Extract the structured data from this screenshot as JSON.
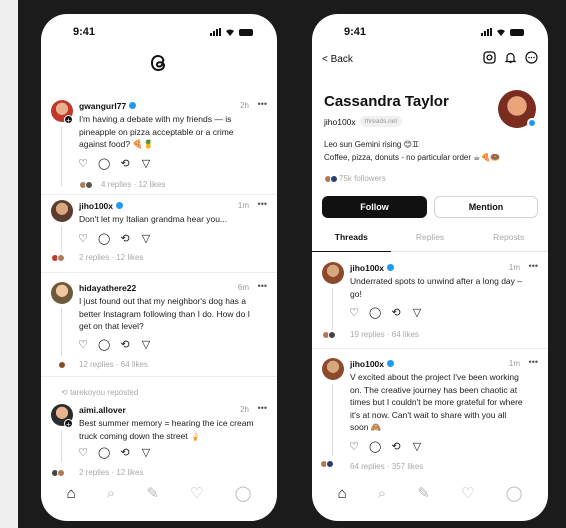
{
  "left_phone": {
    "status_time": "9:41",
    "logo": "@",
    "posts": [
      {
        "username": "gwangurl77",
        "time": "2h",
        "more": "•••",
        "text_lines": [
          "I'm having a debate with my friends — is",
          "pineapple on pizza acceptable or a crime",
          "against food? 🍕🍍"
        ],
        "stats": "4 replies · 12 likes"
      },
      {
        "username": "jiho100x",
        "time": "1m",
        "more": "•••",
        "text_lines": [
          "Don't let my Italian grandma hear you..."
        ],
        "stats": "2 replies · 12 likes"
      },
      {
        "username": "hidayathere22",
        "time": "6m",
        "more": "•••",
        "text_lines": [
          "I just found out that my neighbor's dog has a",
          "better Instagram following than I do. How do I",
          "get on that level?"
        ],
        "stats": "12 replies · 64 likes"
      },
      {
        "reposted_by": "tarekoyou reposted",
        "username": "aimi.allover",
        "time": "2h",
        "more": "•••",
        "text_lines": [
          "Best summer memory = hearing the ice cream",
          "truck coming down the street 🍦"
        ],
        "stats": "2 replies · 12 likes"
      }
    ]
  },
  "right_phone": {
    "status_time": "9:41",
    "back_label": "< Back",
    "profile": {
      "name": "Cassandra Taylor",
      "handle": "jiho100x",
      "chip": "threads.net",
      "bio_line1": "Leo sun Gemini rising 😊♊",
      "bio_line2": "Coffee, pizza, donuts - no particular order ☕🍕🍩",
      "followers": "75k followers"
    },
    "buttons": {
      "follow": "Follow",
      "mention": "Mention"
    },
    "tabs": [
      "Threads",
      "Replies",
      "Reposts"
    ],
    "posts": [
      {
        "username": "jiho100x",
        "time": "1m",
        "more": "•••",
        "text_lines": [
          "Underrated spots to unwind after a long day –",
          "go!"
        ],
        "stats": "19 replies · 64 likes"
      },
      {
        "username": "jiho100x",
        "time": "1m",
        "more": "•••",
        "text_lines": [
          "V excited about the project I've been working",
          "on. The creative journey has been chaotic at",
          "times but I couldn't be more grateful for where",
          "it's at now. Can't wait to share with you all",
          "soon 🙈"
        ],
        "stats": "64 replies · 357 likes"
      }
    ]
  },
  "icons": {
    "like": "♡",
    "reply": "◯",
    "repost": "⟲",
    "share": "▽",
    "home": "⌂",
    "search": "⌕",
    "compose": "✎",
    "activity": "♡",
    "profile": "◯"
  },
  "colors": {
    "verified": "#1d9bf0",
    "follow_button": "#111111",
    "backdrop": "#1b1b1b"
  }
}
